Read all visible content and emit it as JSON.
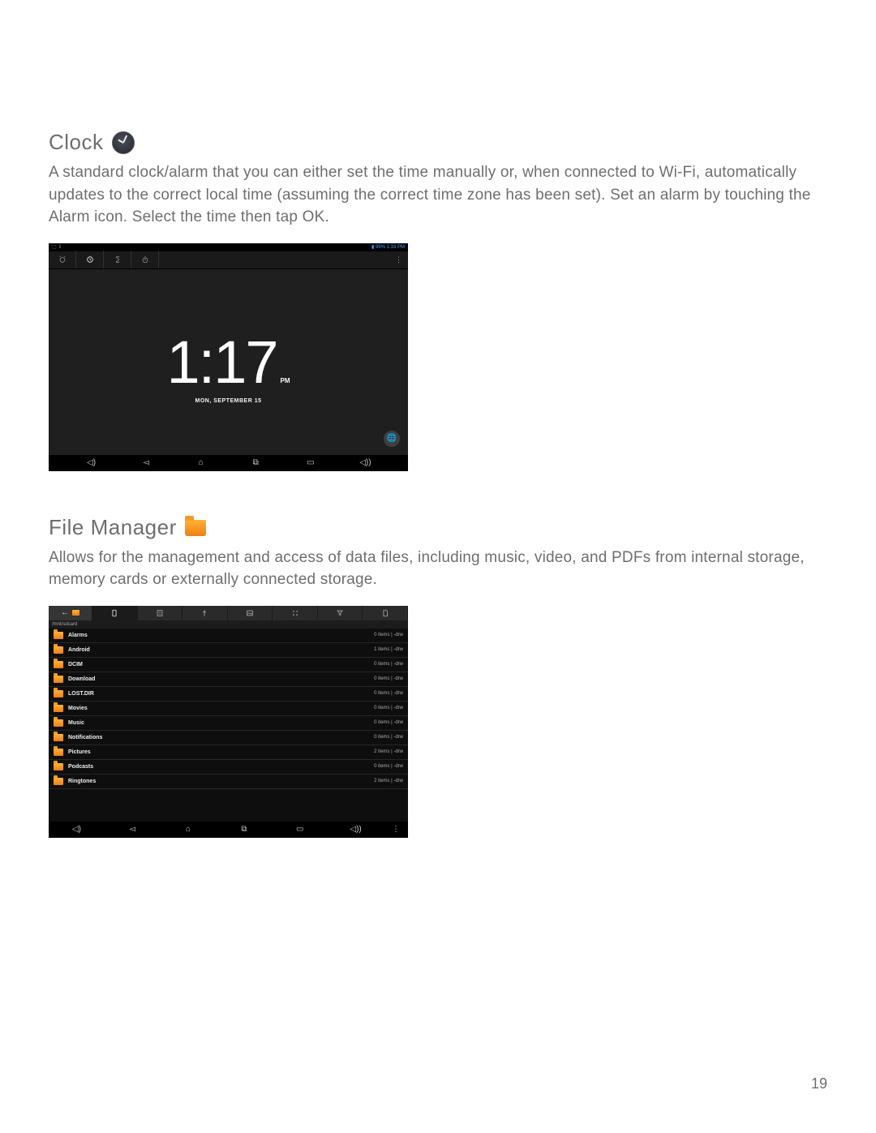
{
  "page_number": "19",
  "sections": {
    "clock": {
      "title": "Clock",
      "body": "A standard clock/alarm that you can either set the time manually or, when connected to Wi-Fi, automatically updates to the correct local time (assuming the correct time zone has been set). Set an alarm by touching the Alarm icon. Select the time then tap OK."
    },
    "file_manager": {
      "title": "File Manager",
      "body": "Allows for the management and access of data files, including music, video, and PDFs from internal storage, memory cards or externally connected storage."
    }
  },
  "clock_screenshot": {
    "status_left": "⬚ ⇩",
    "status_right": "▮ 99% 1:33 PM",
    "time": "1:17",
    "ampm": "PM",
    "date": "MON, SEPTEMBER 15",
    "tab_icons": [
      "alarm-icon",
      "clock-icon",
      "hourglass-icon",
      "stopwatch-icon"
    ],
    "overflow_label": "⋮",
    "fab_label": "🌐",
    "nav_keys": [
      "volume-down-icon",
      "back-icon",
      "home-icon",
      "recent-icon",
      "screenshot-icon",
      "volume-up-icon"
    ]
  },
  "fm_screenshot": {
    "tabs": [
      "device-icon",
      "list-icon",
      "usb-icon",
      "image-icon",
      "apps-icon",
      "filter-icon",
      "file-icon"
    ],
    "path": "/mnt/sdcard",
    "rows": [
      {
        "name": "Alarms",
        "meta": "0 items | -drw"
      },
      {
        "name": "Android",
        "meta": "1 items | -drw"
      },
      {
        "name": "DCIM",
        "meta": "0 items | -drw"
      },
      {
        "name": "Download",
        "meta": "0 items | -drw"
      },
      {
        "name": "LOST.DIR",
        "meta": "0 items | -drw"
      },
      {
        "name": "Movies",
        "meta": "0 items | -drw"
      },
      {
        "name": "Music",
        "meta": "0 items | -drw"
      },
      {
        "name": "Notifications",
        "meta": "0 items | -drw"
      },
      {
        "name": "Pictures",
        "meta": "2 items | -drw"
      },
      {
        "name": "Podcasts",
        "meta": "0 items | -drw"
      },
      {
        "name": "Ringtones",
        "meta": "2 items | -drw"
      }
    ],
    "nav_keys": [
      "volume-down-icon",
      "back-icon",
      "home-icon",
      "recent-icon",
      "screenshot-icon",
      "volume-up-icon"
    ],
    "overflow_label": "⋮"
  }
}
